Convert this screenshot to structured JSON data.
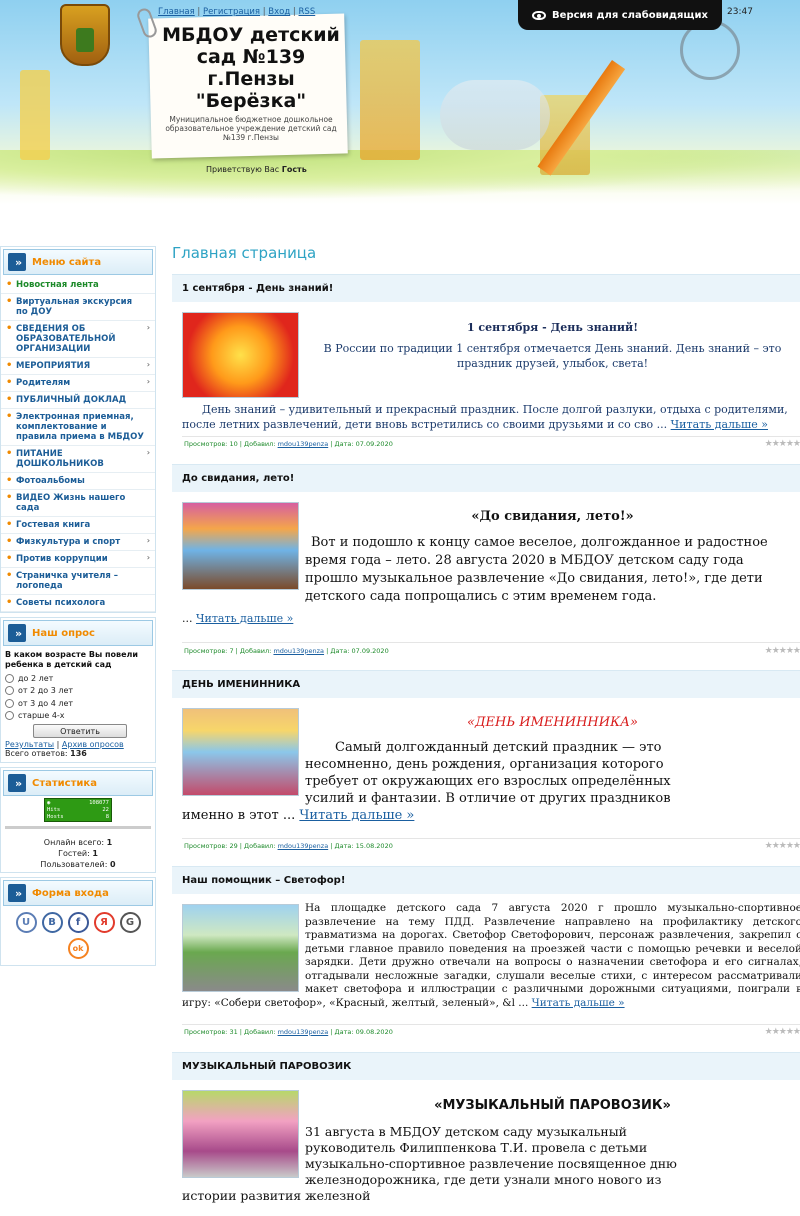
{
  "header": {
    "site_title": "МБДОУ детский сад №139 г.Пензы \"Берёзка\"",
    "site_subtitle": "Муниципальное бюджетное дошкольное образовательное учреждение детский сад №139 г.Пензы",
    "greeting_prefix": "Приветствую Вас",
    "greeting_user": "Гость",
    "top_links": [
      "Главная",
      "Регистрация",
      "Вход",
      "RSS"
    ],
    "accessibility_label": "Версия для слабовидящих",
    "time": "23:47"
  },
  "menu": {
    "title": "Меню сайта",
    "items": [
      {
        "label": "Новостная лента",
        "submenu": false
      },
      {
        "label": "Виртуальная экскурсия по ДОУ",
        "submenu": false
      },
      {
        "label": "СВЕДЕНИЯ ОБ ОБРАЗОВАТЕЛЬНОЙ ОРГАНИЗАЦИИ",
        "submenu": true
      },
      {
        "label": "МЕРОПРИЯТИЯ",
        "submenu": true
      },
      {
        "label": "Родителям",
        "submenu": true
      },
      {
        "label": "ПУБЛИЧНЫЙ ДОКЛАД",
        "submenu": false
      },
      {
        "label": "Электронная приемная, комплектование и правила приема в МБДОУ",
        "submenu": false
      },
      {
        "label": "ПИТАНИЕ ДОШКОЛЬНИКОВ",
        "submenu": true
      },
      {
        "label": "Фотоальбомы",
        "submenu": false
      },
      {
        "label": "ВИДЕО Жизнь нашего сада",
        "submenu": false
      },
      {
        "label": "Гостевая книга",
        "submenu": false
      },
      {
        "label": "Физкультура и спорт",
        "submenu": true
      },
      {
        "label": "Против коррупции",
        "submenu": true
      },
      {
        "label": "Страничка учителя – логопеда",
        "submenu": false
      },
      {
        "label": "Советы психолога",
        "submenu": false
      }
    ]
  },
  "poll": {
    "title": "Наш опрос",
    "question": "В каком возрасте Вы повели ребенка в детский сад",
    "options": [
      "до 2 лет",
      "от 2 до 3 лет",
      "от 3 до 4 лет",
      "старше 4-х"
    ],
    "button": "Ответить",
    "results_link": "Результаты",
    "archive_link": "Архив опросов",
    "total_label": "Всего ответов:",
    "total_value": "136"
  },
  "stats": {
    "title": "Статистика",
    "counter_values": [
      "108077",
      "22",
      "8"
    ],
    "counter_labels": [
      "Hits",
      "Hosts"
    ],
    "online_label": "Онлайн всего:",
    "online_value": "1",
    "guests_label": "Гостей:",
    "guests_value": "1",
    "users_label": "Пользователей:",
    "users_value": "0"
  },
  "login": {
    "title": "Форма входа",
    "social": [
      {
        "name": "ucoz",
        "glyph": "U",
        "color": "#5b7db5"
      },
      {
        "name": "vk",
        "glyph": "B",
        "color": "#3f68a3"
      },
      {
        "name": "facebook",
        "glyph": "f",
        "color": "#3b5998"
      },
      {
        "name": "yandex",
        "glyph": "Я",
        "color": "#e23b2c"
      },
      {
        "name": "google",
        "glyph": "G",
        "color": "#555555"
      },
      {
        "name": "odnoklassniki",
        "glyph": "ok",
        "color": "#f58220"
      }
    ]
  },
  "main": {
    "page_title": "Главная страница",
    "read_more": "Читать дальше »",
    "footer_labels": {
      "views": "Просмотров:",
      "added": "Добавил:",
      "date": "Дата:"
    },
    "posts": [
      {
        "title": "1 сентября - День знаний!",
        "heading": "1 сентября - День знаний!",
        "text_lead": "В России по традиции 1 сентября отмечается День знаний. День знаний – это праздник друзей, улыбок, света!",
        "text": "День знаний – удивительный и прекрасный праздник. После долгой разлуки, отдыха с родителями, после летних развлечений, дети вновь встретились со своими друзьями и со сво ...",
        "views": "10",
        "author": "mdou139penza",
        "date": "07.09.2020"
      },
      {
        "title": "До свидания, лето!",
        "heading": "«До свидания, лето!»",
        "text": "Вот и подошло к концу самое веселое, долгожданное и радостное время года – лето. 28 августа 2020 в МБДОУ детском саду  года прошло музыкальное развлечение «До свидания, лето!», где дети детского сада попрощались с этим временем года.",
        "ellipsis": "...",
        "views": "7",
        "author": "mdou139penza",
        "date": "07.09.2020"
      },
      {
        "title": "ДЕНЬ ИМЕНИННИКА",
        "heading": "«ДЕНЬ ИМЕНИННИКА»",
        "text": "Самый долгожданный детский праздник — это несомненно, день рождения, организация которого требует от окружающих его взрослых определённых усилий и фантазии. В отличие от других праздников именно в этот ...",
        "views": "29",
        "author": "mdou139penza",
        "date": "15.08.2020"
      },
      {
        "title": "Наш помощник – Светофор!",
        "text": "На площадке детского сада 7 августа 2020 г прошло музыкально-спортивное развлечение на тему ПДД.  Развлечение направлено  на профилактику  детского травматизма на дорогах. Светофор Светофорович, персонаж развлечения, закрепил с детьми главное правило поведения на проезжей части с помощью речевки и веселой зарядки. Дети дружно отвечали на вопросы о назначении светофора и его сигналах, отгадывали несложные загадки, слушали веселые стихи, с интересом рассматривали макет светофора и иллюстрации с различными дорожными ситуациями, поиграли в игру: «Собери светофор», «Красный, желтый, зеленый», &l ...",
        "views": "31",
        "author": "mdou139penza",
        "date": "09.08.2020"
      },
      {
        "title": "МУЗЫКАЛЬНЫЙ ПАРОВОЗИК",
        "heading": "«МУЗЫКАЛЬНЫЙ ПАРОВОЗИК»",
        "text": "31 августа в МБДОУ детском саду музыкальный руководитель Филиппенкова Т.И. провела с детьми музыкально-спортивное развлечение посвященное дню железнодорожника, где дети узнали много нового из истории развития железной"
      }
    ]
  },
  "colors": {
    "accent_orange": "#f08a00",
    "link_blue": "#1a5fa0",
    "title_cyan": "#2ea3c4",
    "footer_green": "#1d8a2a"
  }
}
